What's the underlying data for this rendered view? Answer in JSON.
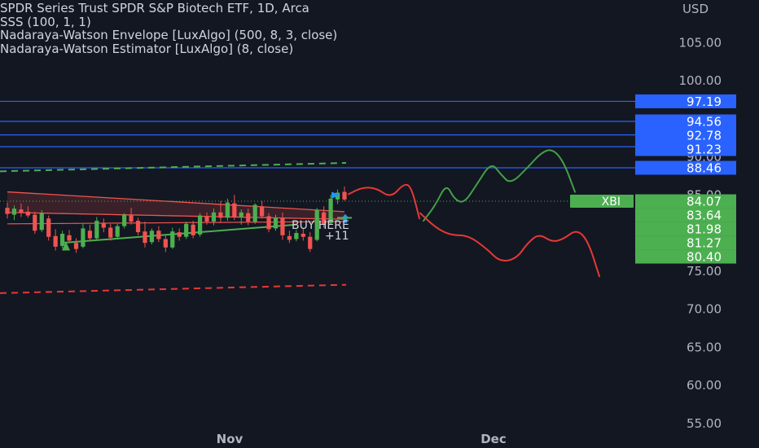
{
  "legend": {
    "line1": "SPDR Series Trust SPDR S&P Biotech ETF, 1D, Arca",
    "line2": "SSS (100, 1, 1)",
    "line3": "Nadaraya-Watson Envelope [LuxAlgo] (500, 8, 3, close)",
    "line4": "Nadaraya-Watson Estimator [LuxAlgo] (8, close)"
  },
  "price_axis": {
    "currency": "USD",
    "ticks": [
      "105.00",
      "100.00",
      "90.00",
      "85.00",
      "75.00",
      "70.00",
      "65.00",
      "60.00",
      "55.00"
    ],
    "tick_values": [
      105,
      100,
      90,
      85,
      75,
      70,
      65,
      60,
      55
    ]
  },
  "time_axis": {
    "labels": [
      "Nov",
      "Dec"
    ]
  },
  "colors": {
    "background": "#131722",
    "up": "#4caf50",
    "down": "#f05350",
    "level_line": "#2962ff",
    "text": "#d1d4dc",
    "axis_text": "#b2b5be",
    "envelope_upper": "#4caf50",
    "envelope_lower": "#e53935",
    "projection_bull": "#43a047",
    "projection_bear": "#e53935"
  },
  "annotations": {
    "buy_text": "BUY HERE",
    "count_text": "+11"
  },
  "chart_data": {
    "type": "candlestick",
    "title": "SPDR Series Trust SPDR S&P Biotech ETF, 1D, Arca",
    "symbol": "XBI",
    "ylim": [
      53.8,
      110.5
    ],
    "grid": false,
    "x_labels": [
      "Nov",
      "Dec"
    ],
    "current_price": 84.07,
    "horizontal_levels": [
      97.19,
      94.56,
      92.78,
      91.23,
      88.46
    ],
    "right_axis_badges": [
      {
        "label": "97.19",
        "value": 97.19,
        "color": "#2962ff"
      },
      {
        "label": "94.56",
        "value": 94.56,
        "color": "#2962ff"
      },
      {
        "label": "92.78",
        "value": 92.78,
        "color": "#2962ff"
      },
      {
        "label": "91.23",
        "value": 91.23,
        "color": "#2962ff"
      },
      {
        "label": "88.46",
        "value": 88.46,
        "color": "#2962ff"
      },
      {
        "label": "84.07",
        "value": 84.07,
        "color": "#4caf50"
      },
      {
        "label": "83.64",
        "value": 83.64,
        "color": "#4caf50"
      },
      {
        "label": "81.98",
        "value": 81.98,
        "color": "#4caf50"
      },
      {
        "label": "81.27",
        "value": 81.27,
        "color": "#4caf50"
      },
      {
        "label": "80.40",
        "value": 80.4,
        "color": "#4caf50"
      }
    ],
    "symbol_tag": {
      "label": "XBI",
      "value": 84.07,
      "color": "#4caf50"
    },
    "candles": [
      {
        "o": 83.2,
        "h": 83.9,
        "l": 81.8,
        "c": 82.4
      },
      {
        "o": 82.3,
        "h": 83.5,
        "l": 81.6,
        "c": 83.1
      },
      {
        "o": 83.0,
        "h": 83.8,
        "l": 82.0,
        "c": 82.6
      },
      {
        "o": 82.7,
        "h": 83.4,
        "l": 81.9,
        "c": 82.2
      },
      {
        "o": 82.3,
        "h": 82.7,
        "l": 79.8,
        "c": 80.2
      },
      {
        "o": 80.3,
        "h": 82.9,
        "l": 80.0,
        "c": 82.5
      },
      {
        "o": 81.8,
        "h": 82.2,
        "l": 78.9,
        "c": 79.4
      },
      {
        "o": 79.5,
        "h": 80.4,
        "l": 77.6,
        "c": 78.1
      },
      {
        "o": 78.2,
        "h": 80.2,
        "l": 77.9,
        "c": 79.8
      },
      {
        "o": 79.6,
        "h": 80.3,
        "l": 78.6,
        "c": 78.9
      },
      {
        "o": 78.6,
        "h": 79.2,
        "l": 77.3,
        "c": 77.8
      },
      {
        "o": 78.1,
        "h": 81.2,
        "l": 77.9,
        "c": 80.5
      },
      {
        "o": 80.2,
        "h": 81.0,
        "l": 78.8,
        "c": 79.2
      },
      {
        "o": 79.2,
        "h": 82.0,
        "l": 78.9,
        "c": 81.5
      },
      {
        "o": 81.2,
        "h": 81.8,
        "l": 80.0,
        "c": 80.6
      },
      {
        "o": 80.6,
        "h": 81.1,
        "l": 78.9,
        "c": 79.3
      },
      {
        "o": 79.4,
        "h": 81.1,
        "l": 79.1,
        "c": 80.8
      },
      {
        "o": 80.8,
        "h": 82.5,
        "l": 80.5,
        "c": 82.3
      },
      {
        "o": 82.2,
        "h": 83.2,
        "l": 81.0,
        "c": 81.4
      },
      {
        "o": 81.5,
        "h": 81.9,
        "l": 79.6,
        "c": 80.0
      },
      {
        "o": 80.1,
        "h": 81.4,
        "l": 78.0,
        "c": 78.6
      },
      {
        "o": 78.7,
        "h": 80.5,
        "l": 78.4,
        "c": 80.2
      },
      {
        "o": 80.2,
        "h": 80.8,
        "l": 78.7,
        "c": 79.1
      },
      {
        "o": 79.1,
        "h": 79.6,
        "l": 77.4,
        "c": 78.0
      },
      {
        "o": 78.0,
        "h": 80.6,
        "l": 77.8,
        "c": 80.1
      },
      {
        "o": 80.0,
        "h": 80.5,
        "l": 78.9,
        "c": 79.4
      },
      {
        "o": 79.4,
        "h": 81.4,
        "l": 79.1,
        "c": 81.1
      },
      {
        "o": 81.0,
        "h": 81.5,
        "l": 79.2,
        "c": 79.6
      },
      {
        "o": 79.7,
        "h": 82.5,
        "l": 79.4,
        "c": 82.2
      },
      {
        "o": 82.1,
        "h": 82.6,
        "l": 81.0,
        "c": 81.4
      },
      {
        "o": 81.4,
        "h": 83.1,
        "l": 80.9,
        "c": 82.6
      },
      {
        "o": 82.6,
        "h": 84.1,
        "l": 81.2,
        "c": 81.9
      },
      {
        "o": 81.9,
        "h": 84.4,
        "l": 81.5,
        "c": 83.9
      },
      {
        "o": 83.8,
        "h": 84.9,
        "l": 81.6,
        "c": 82.0
      },
      {
        "o": 82.0,
        "h": 83.0,
        "l": 81.0,
        "c": 82.6
      },
      {
        "o": 82.5,
        "h": 83.1,
        "l": 80.9,
        "c": 81.4
      },
      {
        "o": 81.4,
        "h": 83.8,
        "l": 81.1,
        "c": 83.6
      },
      {
        "o": 83.4,
        "h": 84.1,
        "l": 81.8,
        "c": 82.1
      },
      {
        "o": 82.1,
        "h": 82.5,
        "l": 80.0,
        "c": 80.4
      },
      {
        "o": 80.5,
        "h": 82.3,
        "l": 80.2,
        "c": 81.9
      },
      {
        "o": 81.9,
        "h": 82.6,
        "l": 79.0,
        "c": 79.6
      },
      {
        "o": 79.5,
        "h": 80.2,
        "l": 78.6,
        "c": 79.0
      },
      {
        "o": 79.1,
        "h": 80.3,
        "l": 78.8,
        "c": 79.9
      },
      {
        "o": 79.8,
        "h": 80.5,
        "l": 78.9,
        "c": 79.4
      },
      {
        "o": 79.4,
        "h": 80.0,
        "l": 77.4,
        "c": 77.8
      },
      {
        "o": 79.0,
        "h": 83.2,
        "l": 78.8,
        "c": 82.9
      },
      {
        "o": 82.6,
        "h": 83.4,
        "l": 80.6,
        "c": 81.1
      },
      {
        "o": 81.2,
        "h": 84.9,
        "l": 81.0,
        "c": 84.4
      },
      {
        "o": 84.3,
        "h": 85.6,
        "l": 83.7,
        "c": 85.2
      },
      {
        "o": 85.3,
        "h": 86.0,
        "l": 84.1,
        "c": 84.3
      }
    ]
  }
}
